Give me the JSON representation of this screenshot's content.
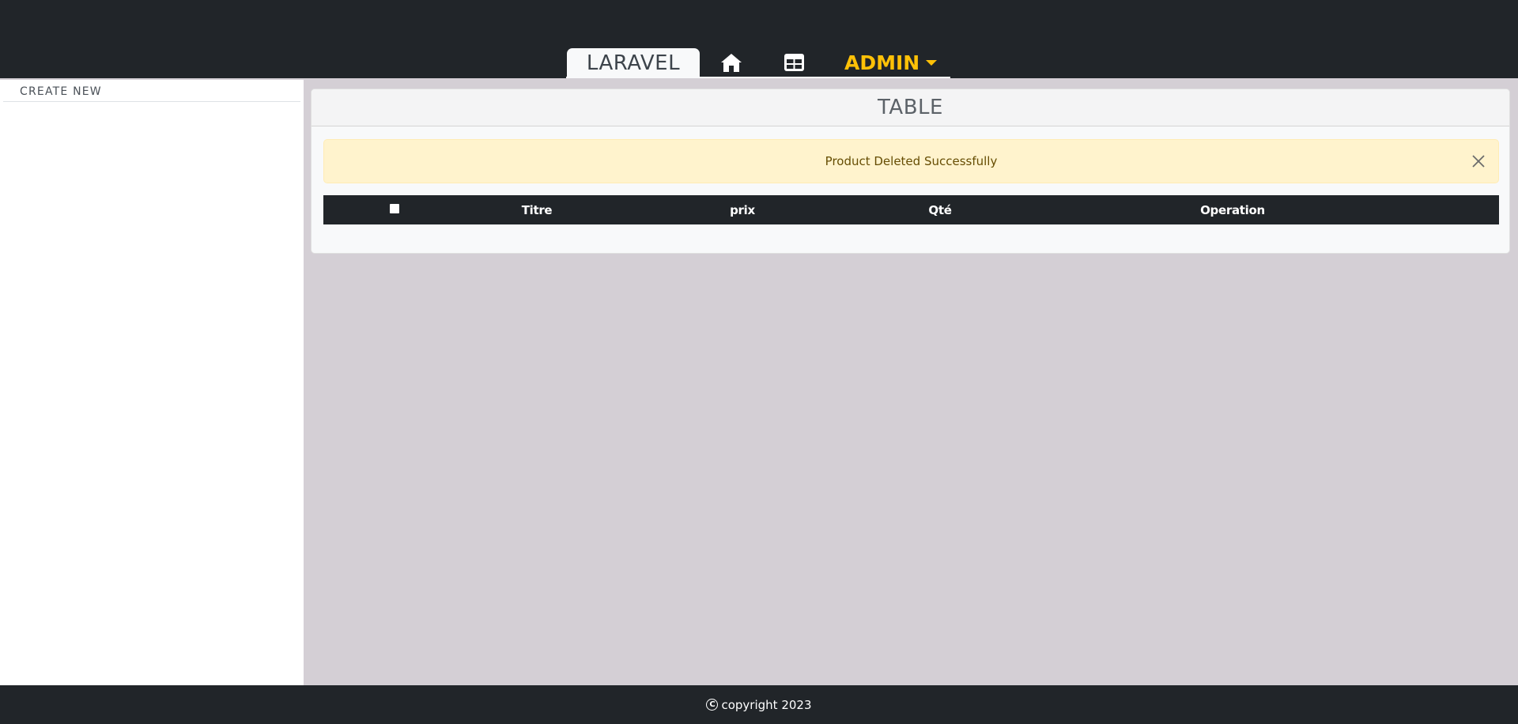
{
  "navbar": {
    "brand_label": "LARAVEL",
    "home_icon": "home-icon",
    "table_icon": "table-icon",
    "admin_label": "ADMIN",
    "admin_caret_icon": "caret-down-icon",
    "colors": {
      "background": "#212529",
      "admin": "#ffc107",
      "brand_tab": "#f8f9fa"
    }
  },
  "sidebar": {
    "items": [
      {
        "label": "CREATE NEW"
      }
    ]
  },
  "main": {
    "card_title": "TABLE",
    "alert": {
      "message": "Product Deleted Successfully",
      "close_icon": "close-icon",
      "color": "#fff3cd"
    },
    "table": {
      "headers": [
        "Titre",
        "prix",
        "Qté",
        "Operation"
      ],
      "rows": []
    }
  },
  "footer": {
    "copyright_icon": "copyright-icon",
    "text": "copyright 2023"
  }
}
